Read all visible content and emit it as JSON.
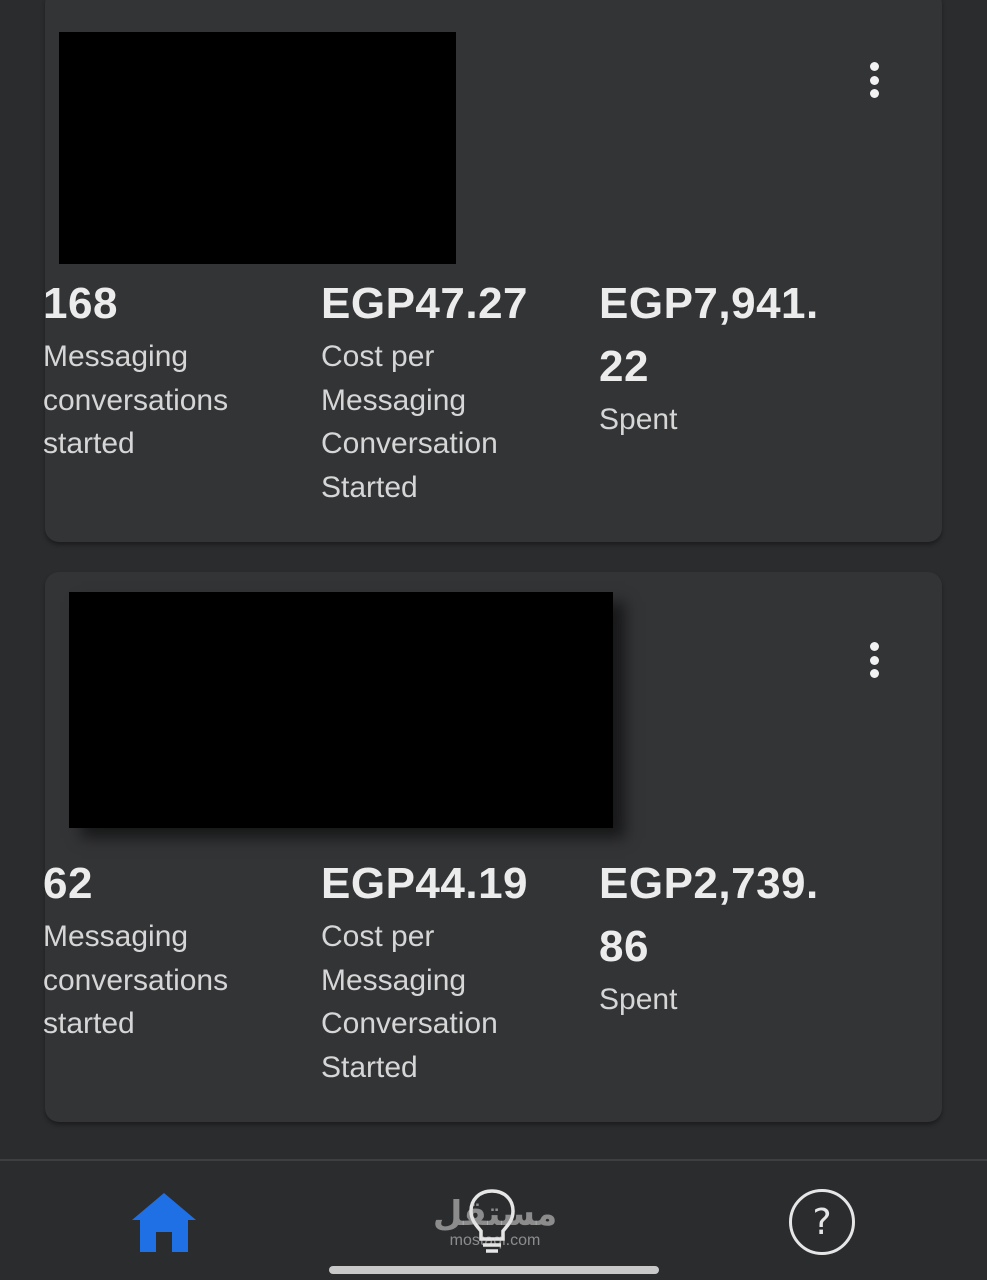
{
  "cards": [
    {
      "metrics": [
        {
          "value": "168",
          "label": "Messaging conversations started"
        },
        {
          "value": "EGP47.27",
          "label": "Cost per Messaging Conversation Started"
        },
        {
          "value": "EGP7,941.22",
          "label": "Spent"
        }
      ]
    },
    {
      "metrics": [
        {
          "value": "62",
          "label": "Messaging conversations started"
        },
        {
          "value": "EGP44.19",
          "label": "Cost per Messaging Conversation Started"
        },
        {
          "value": "EGP2,739.86",
          "label": "Spent"
        }
      ]
    }
  ],
  "bottom_nav": {
    "items": [
      {
        "icon": "home-icon",
        "active": true,
        "color": "#1f6fe5"
      },
      {
        "icon": "lightbulb-icon",
        "active": false,
        "color": "#e6e6e6"
      },
      {
        "icon": "help-icon",
        "glyph": "?",
        "active": false,
        "color": "#e6e6e6"
      }
    ]
  },
  "watermark": {
    "arabic": "مستقل",
    "latin": "mostaql.com"
  },
  "colors": {
    "background": "#2b2c2e",
    "card": "#333436",
    "accent": "#1f6fe5",
    "text": "#ececec"
  }
}
